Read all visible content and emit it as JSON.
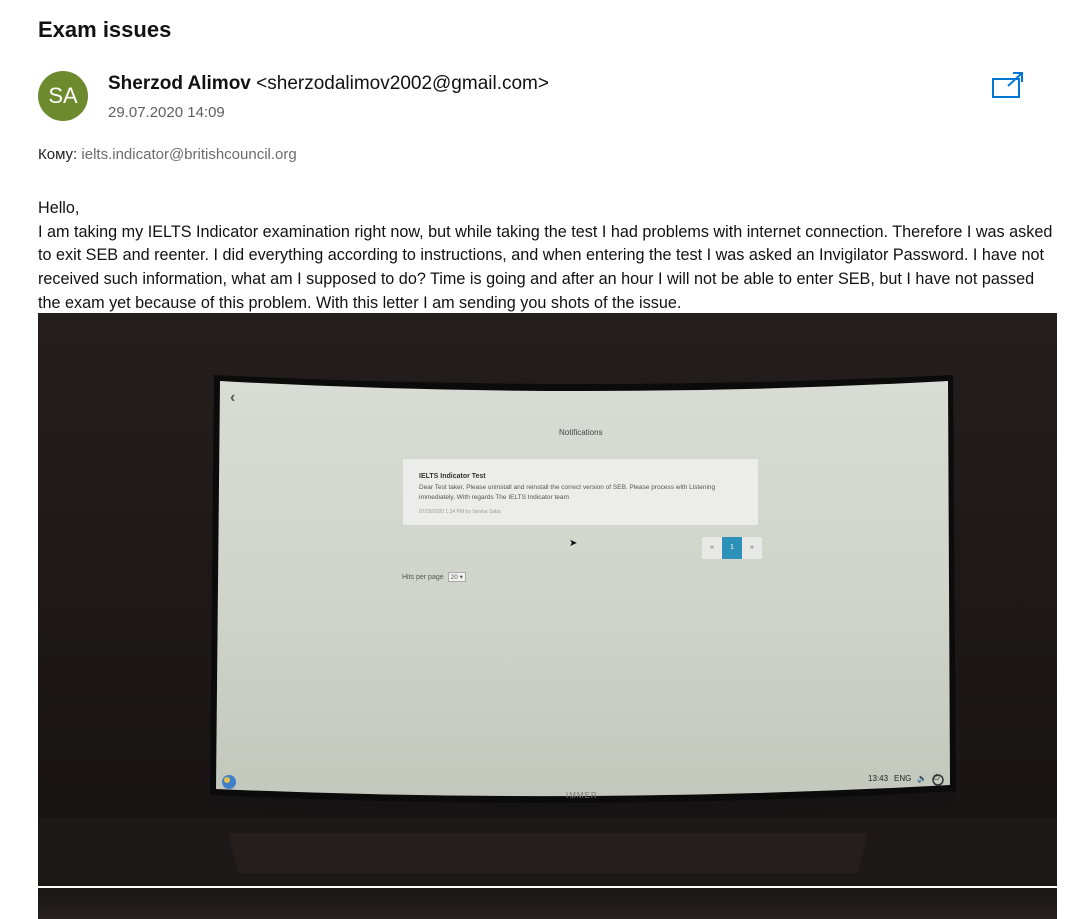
{
  "subject": "Exam issues",
  "sender": {
    "initials": "SA",
    "name": "Sherzod Alimov",
    "email": "<sherzodalimov2002@gmail.com>",
    "avatar_color": "#6e8a2e"
  },
  "date": "29.07.2020 14:09",
  "recipient": {
    "label": "Кому:",
    "address": "ielts.indicator@britishcouncil.org"
  },
  "body": {
    "greeting": "Hello,",
    "text": "I am taking my IELTS Indicator examination right now, but while taking the test I had problems with internet connection. Therefore I was asked to exit SEB and reenter. I did everything according to instructions, and when entering the test I was asked an Invigilator Password. I have not received such information, what am I supposed to do? Time is going and after an hour I will not be able to enter SEB, but I have not passed the exam yet because of this problem. With this letter I am sending you shots of the issue."
  },
  "attachment_photo": {
    "page_title": "Notifications",
    "notification": {
      "title": "IELTS Indicator Test",
      "text": "Dear Test taker, Please uninstall and reinstall the correct version of SEB. Please process with Listening immediately. With regards The IELTS Indicator team",
      "meta": "07/29/2020 1:34 PM by Varsha Sabu"
    },
    "pager": {
      "prev": "«",
      "current": "1",
      "next": "»"
    },
    "hits_label": "Hits per page",
    "hits_value": "20",
    "taskbar": {
      "time": "13:43",
      "lang": "ENG"
    },
    "monitor_brand": "IMMER"
  },
  "colors": {
    "accent": "#0078d4",
    "pager_active": "#2d90b8"
  }
}
